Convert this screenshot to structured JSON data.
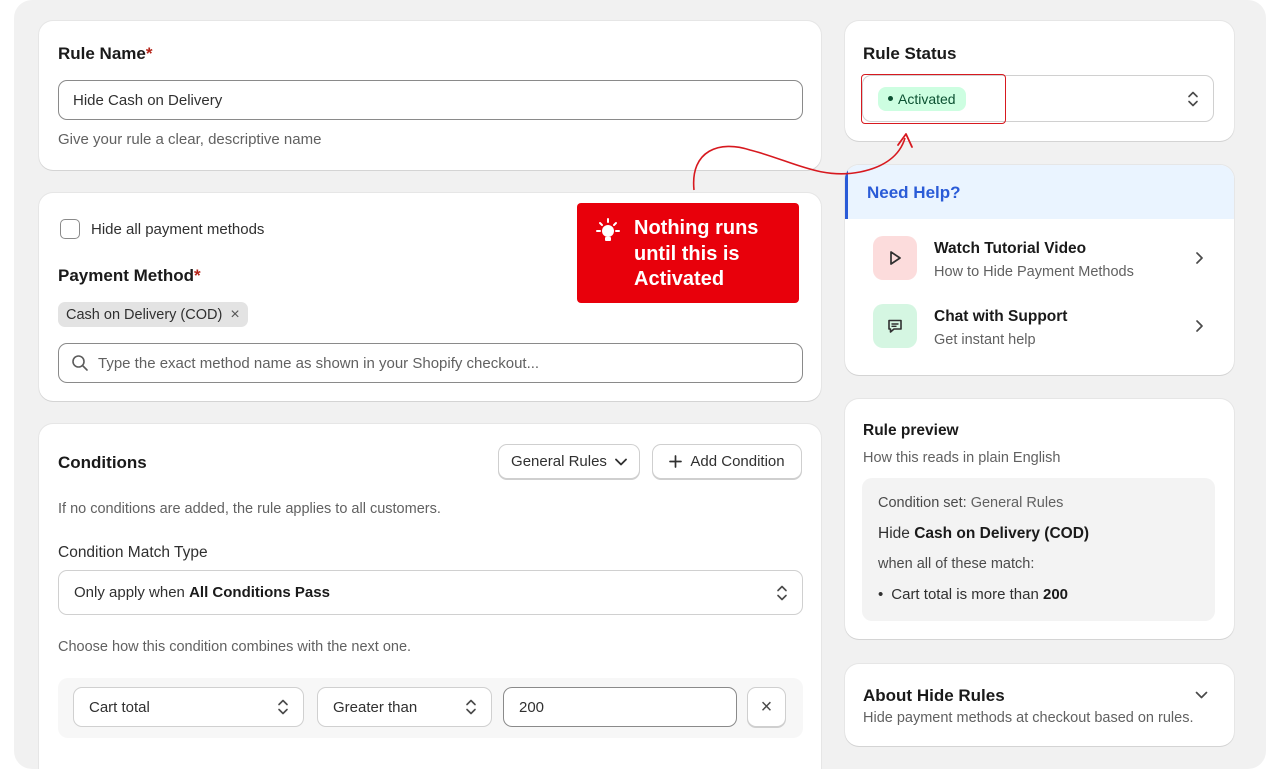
{
  "rule_name": {
    "label": "Rule Name",
    "required_mark": "*",
    "value": "Hide Cash on Delivery",
    "help": "Give your rule a clear, descriptive name"
  },
  "payment": {
    "hide_all_label": "Hide all payment methods",
    "method_label": "Payment Method",
    "required_mark": "*",
    "chip": "Cash on Delivery (COD)",
    "chip_remove": "×",
    "search_placeholder": "Type the exact method name as shown in your Shopify checkout..."
  },
  "callout": {
    "text": "Nothing runs until this is Activated",
    "bg_color": "#e8000b"
  },
  "conditions": {
    "title": "Conditions",
    "rules_button": "General Rules",
    "add_button": "Add Condition",
    "note": "If no conditions are added, the rule applies to all customers.",
    "match_type_label": "Condition Match Type",
    "match_prefix": "Only apply when ",
    "match_value": "All Conditions Pass",
    "combine_note": "Choose how this condition combines with the next one.",
    "field": "Cart total",
    "operator": "Greater than",
    "value": "200",
    "remove": "×"
  },
  "status": {
    "title": "Rule Status",
    "badge": "Activated",
    "badge_bg": "#cdfee1",
    "highlight_color": "#d7191f"
  },
  "help": {
    "title": "Need Help?",
    "accent": "#2a5bd7",
    "items": [
      {
        "title": "Watch Tutorial Video",
        "subtitle": "How to Hide Payment Methods",
        "icon": "play-icon"
      },
      {
        "title": "Chat with Support",
        "subtitle": "Get instant help",
        "icon": "chat-icon"
      }
    ]
  },
  "preview": {
    "title": "Rule preview",
    "subtitle": "How this reads in plain English",
    "condition_set_label": "Condition set:",
    "condition_set_value": "General Rules",
    "hide_word": "Hide",
    "hide_target": "Cash on Delivery (COD)",
    "when_text": "when all of these match:",
    "bullet_prefix": "Cart total is more than",
    "bullet_value": "200"
  },
  "about": {
    "title": "About Hide Rules",
    "subtitle": "Hide payment methods at checkout based on rules."
  }
}
